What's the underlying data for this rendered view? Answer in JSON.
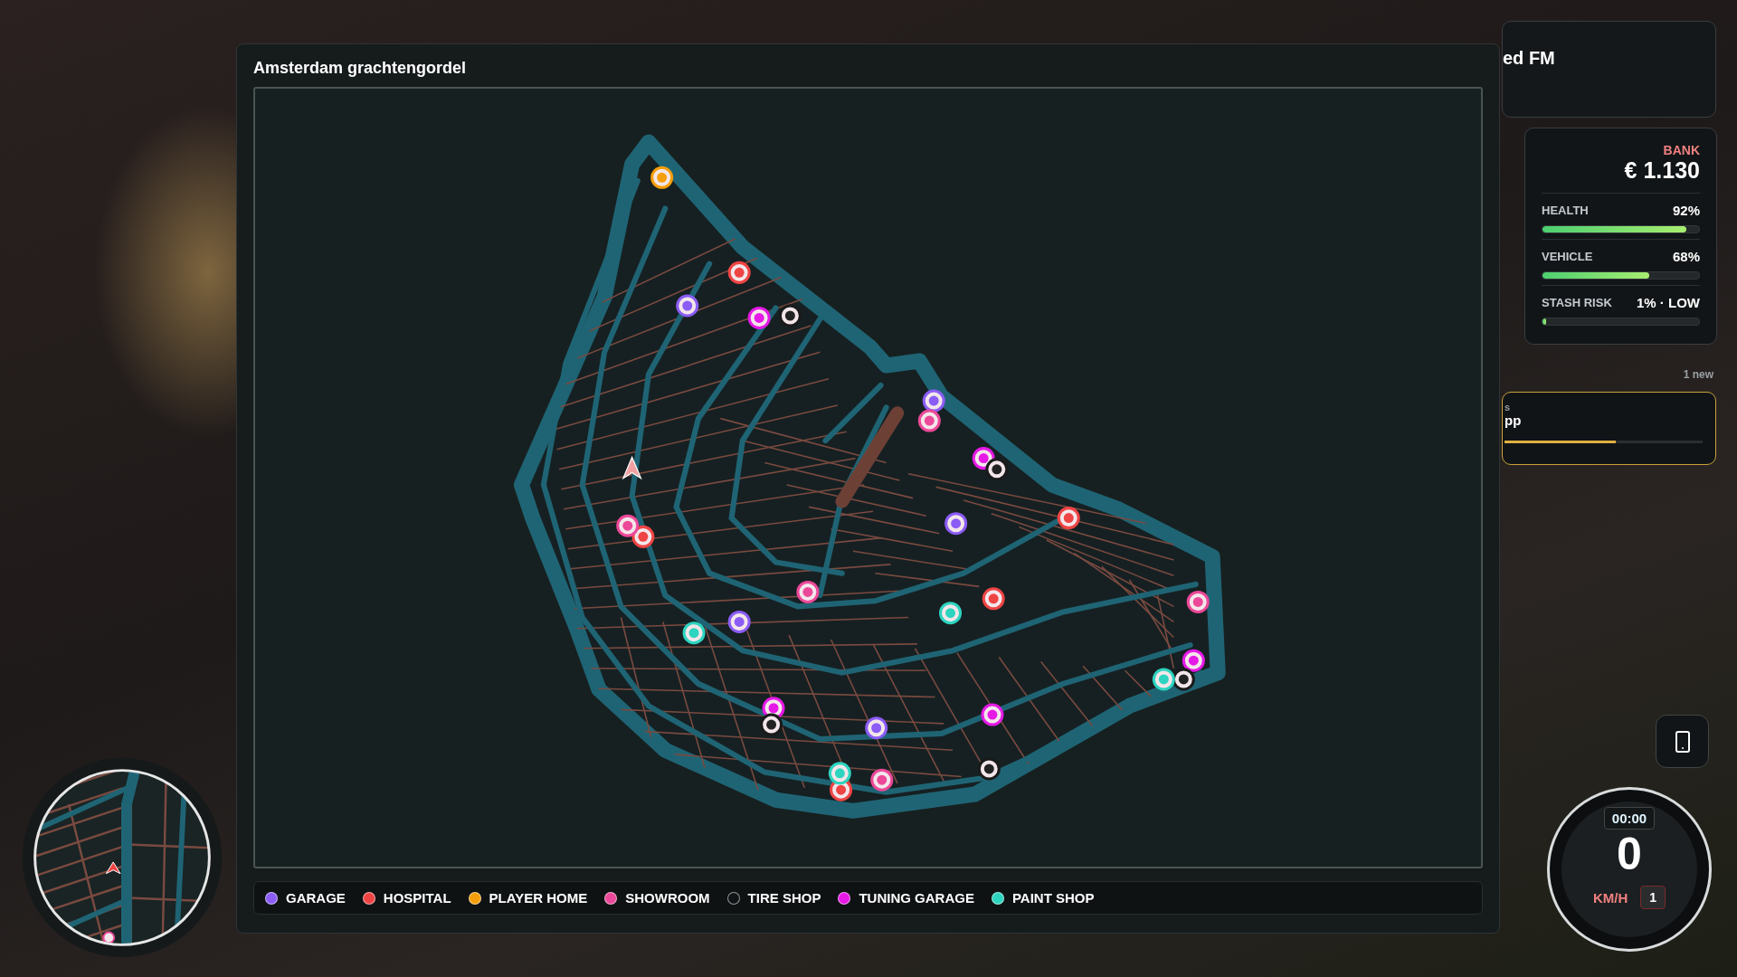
{
  "map_window": {
    "title": "Amsterdam grachtengordel",
    "legend": [
      {
        "label": "GARAGE",
        "color": "#8b5cf6"
      },
      {
        "label": "HOSPITAL",
        "color": "#ef4444"
      },
      {
        "label": "PLAYER HOME",
        "color": "#f59e0b"
      },
      {
        "label": "SHOWROOM",
        "color": "#ec4899"
      },
      {
        "label": "TIRE SHOP",
        "color": "#111416"
      },
      {
        "label": "TUNING GARAGE",
        "color": "#e619e6"
      },
      {
        "label": "PAINT SHOP",
        "color": "#2dd4bf"
      }
    ]
  },
  "radio": {
    "station": "ed FM"
  },
  "stats": {
    "bank_label": "BANK",
    "bank_value": "€ 1.130",
    "meters": [
      {
        "label": "HEALTH",
        "reading": "92%",
        "level": 0.92
      },
      {
        "label": "VEHICLE",
        "reading": "68%",
        "level": 0.68
      },
      {
        "label": "STASH RISK",
        "reading": "1% · LOW",
        "level": 0.01
      }
    ]
  },
  "notifications": {
    "count": "1 new",
    "line_1": "s",
    "line_2": "pp",
    "level": 0.56
  },
  "speedometer": {
    "time": "00:00",
    "speed": "0",
    "unit": "KM/H",
    "gear": "1"
  }
}
